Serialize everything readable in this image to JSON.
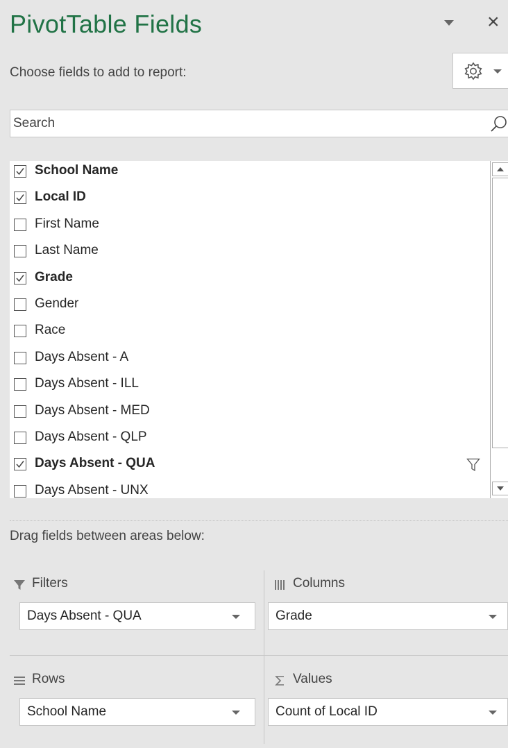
{
  "header": {
    "title": "PivotTable Fields",
    "close_glyph": "×",
    "choose_label": "Choose fields to add to report:"
  },
  "search": {
    "placeholder": "Search"
  },
  "fields": [
    {
      "label": "School Name",
      "checked": true,
      "filtered": false
    },
    {
      "label": "Local ID",
      "checked": true,
      "filtered": false
    },
    {
      "label": "First Name",
      "checked": false,
      "filtered": false
    },
    {
      "label": "Last Name",
      "checked": false,
      "filtered": false
    },
    {
      "label": "Grade",
      "checked": true,
      "filtered": false
    },
    {
      "label": "Gender",
      "checked": false,
      "filtered": false
    },
    {
      "label": "Race",
      "checked": false,
      "filtered": false
    },
    {
      "label": "Days Absent - A",
      "checked": false,
      "filtered": false
    },
    {
      "label": "Days Absent - ILL",
      "checked": false,
      "filtered": false
    },
    {
      "label": "Days Absent - MED",
      "checked": false,
      "filtered": false
    },
    {
      "label": "Days Absent - QLP",
      "checked": false,
      "filtered": false
    },
    {
      "label": "Days Absent - QUA",
      "checked": true,
      "filtered": true
    },
    {
      "label": "Days Absent - UNX",
      "checked": false,
      "filtered": false
    }
  ],
  "areas": {
    "drag_label": "Drag fields between areas below:",
    "filters": {
      "label": "Filters",
      "icon": "funnel-icon",
      "value": "Days Absent - QUA"
    },
    "columns": {
      "label": "Columns",
      "icon": "columns-icon",
      "value": "Grade"
    },
    "rows": {
      "label": "Rows",
      "icon": "rows-icon",
      "value": "School Name"
    },
    "values": {
      "label": "Values",
      "icon": "sigma-icon",
      "value": "Count of Local ID"
    }
  },
  "colors": {
    "title": "#217346",
    "background": "#e6e6e6",
    "text": "#262626"
  }
}
